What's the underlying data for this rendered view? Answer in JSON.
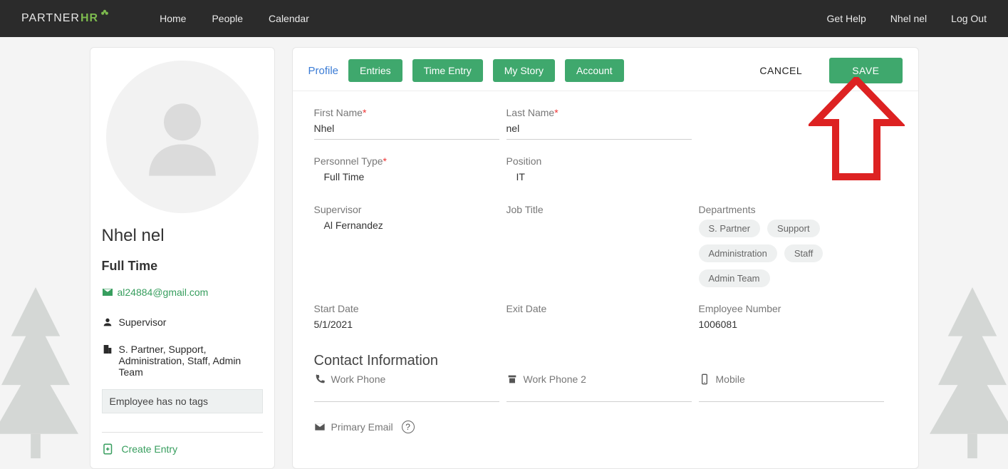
{
  "brand": {
    "part1": "PARTNER",
    "part2": "HR"
  },
  "nav": {
    "home": "Home",
    "people": "People",
    "calendar": "Calendar"
  },
  "topRight": {
    "help": "Get Help",
    "user": "Nhel nel",
    "logout": "Log Out"
  },
  "sidebar": {
    "name": "Nhel nel",
    "type": "Full Time",
    "email": "al24884@gmail.com",
    "supervisor_label": "Supervisor",
    "departments_text": "S. Partner, Support, Administration, Staff, Admin Team",
    "no_tags": "Employee has no tags",
    "create_entry": "Create Entry"
  },
  "tabs": {
    "profile": "Profile",
    "entries": "Entries",
    "time_entry": "Time Entry",
    "my_story": "My Story",
    "account": "Account",
    "cancel": "CANCEL",
    "save": "SAVE"
  },
  "form": {
    "first_name_label": "First Name",
    "first_name": "Nhel",
    "last_name_label": "Last Name",
    "last_name": "nel",
    "personnel_type_label": "Personnel Type",
    "personnel_type": "Full Time",
    "position_label": "Position",
    "position": "IT",
    "supervisor_label": "Supervisor",
    "supervisor": "Al Fernandez",
    "job_title_label": "Job Title",
    "departments_label": "Departments",
    "departments": [
      "S. Partner",
      "Support",
      "Administration",
      "Staff",
      "Admin Team"
    ],
    "start_date_label": "Start Date",
    "start_date": "5/1/2021",
    "exit_date_label": "Exit Date",
    "employee_number_label": "Employee Number",
    "employee_number": "1006081"
  },
  "contact": {
    "section": "Contact Information",
    "work_phone": "Work Phone",
    "work_phone2": "Work Phone 2",
    "mobile": "Mobile",
    "primary_email": "Primary Email"
  }
}
